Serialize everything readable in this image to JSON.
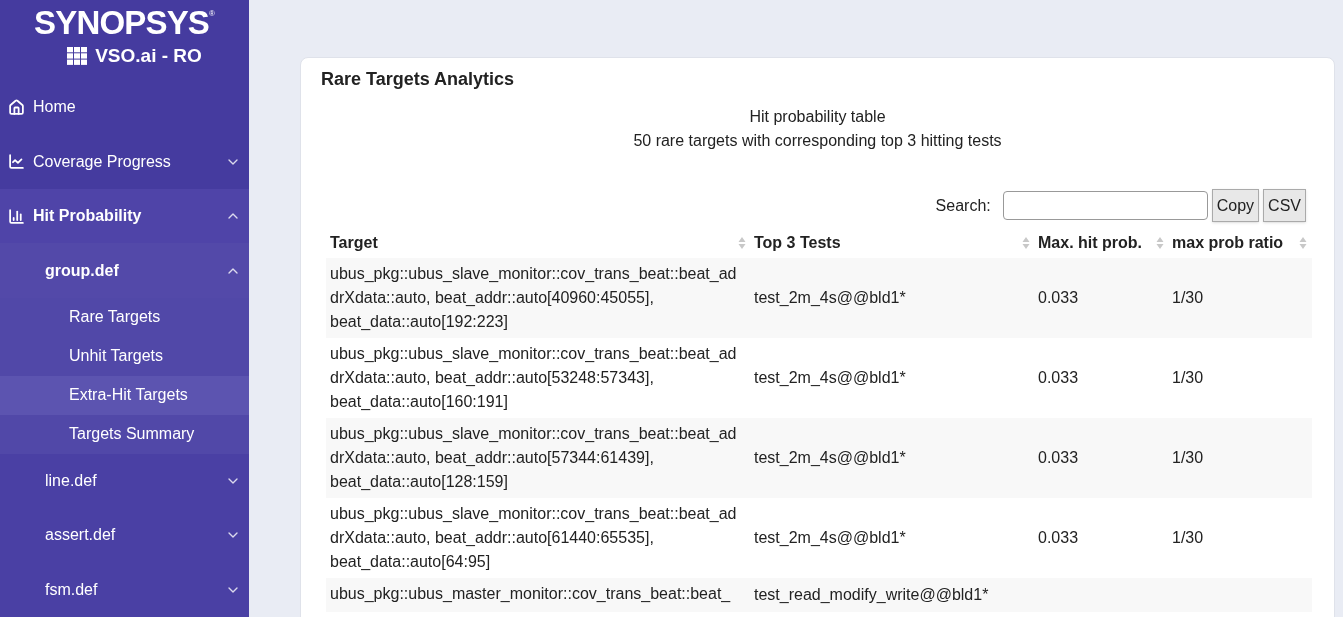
{
  "sidebar": {
    "brand": "SYNOPSYS",
    "brand_mark": "®",
    "product": "VSO.ai - RO",
    "items": [
      {
        "label": "Home",
        "selected": false
      },
      {
        "label": "Coverage Progress",
        "selected": false,
        "expanded": false
      },
      {
        "label": "Hit Probability",
        "selected": true,
        "expanded": true,
        "children": [
          {
            "label": "group.def",
            "selected": true,
            "expanded": true,
            "children": [
              {
                "label": "Rare Targets",
                "selected": false
              },
              {
                "label": "Unhit Targets",
                "selected": false
              },
              {
                "label": "Extra-Hit Targets",
                "selected": true
              },
              {
                "label": "Targets Summary",
                "selected": false
              }
            ]
          },
          {
            "label": "line.def",
            "selected": false,
            "expanded": false
          },
          {
            "label": "assert.def",
            "selected": false,
            "expanded": false
          },
          {
            "label": "fsm.def",
            "selected": false,
            "expanded": false
          }
        ]
      }
    ]
  },
  "card": {
    "title": "Rare Targets Analytics",
    "caption": [
      "Hit probability table",
      "50 rare targets with corresponding top 3 hitting tests"
    ],
    "search": {
      "label": "Search:"
    },
    "buttons": [
      "Copy",
      "CSV"
    ],
    "table": {
      "columns": [
        "Target",
        "Top 3 Tests",
        "Max. hit prob.",
        "max prob ratio"
      ],
      "rows": [
        {
          "target": [
            "ubus_pkg::ubus_slave_monitor::cov_trans_beat::beat_ad",
            "drXdata::auto, beat_addr::auto[40960:45055],",
            "beat_data::auto[192:223]"
          ],
          "tests": "test_2m_4s@@bld1*",
          "max": "0.033",
          "ratio": "1/30"
        },
        {
          "target": [
            "ubus_pkg::ubus_slave_monitor::cov_trans_beat::beat_ad",
            "drXdata::auto, beat_addr::auto[53248:57343],",
            "beat_data::auto[160:191]"
          ],
          "tests": "test_2m_4s@@bld1*",
          "max": "0.033",
          "ratio": "1/30"
        },
        {
          "target": [
            "ubus_pkg::ubus_slave_monitor::cov_trans_beat::beat_ad",
            "drXdata::auto, beat_addr::auto[57344:61439],",
            "beat_data::auto[128:159]"
          ],
          "tests": "test_2m_4s@@bld1*",
          "max": "0.033",
          "ratio": "1/30"
        },
        {
          "target": [
            "ubus_pkg::ubus_slave_monitor::cov_trans_beat::beat_ad",
            "drXdata::auto, beat_addr::auto[61440:65535],",
            "beat_data::auto[64:95]"
          ],
          "tests": "test_2m_4s@@bld1*",
          "max": "0.033",
          "ratio": "1/30"
        },
        {
          "target": [
            "ubus_pkg::ubus_master_monitor::cov_trans_beat::beat_"
          ],
          "tests": "test_read_modify_write@@bld1*"
        }
      ]
    }
  }
}
